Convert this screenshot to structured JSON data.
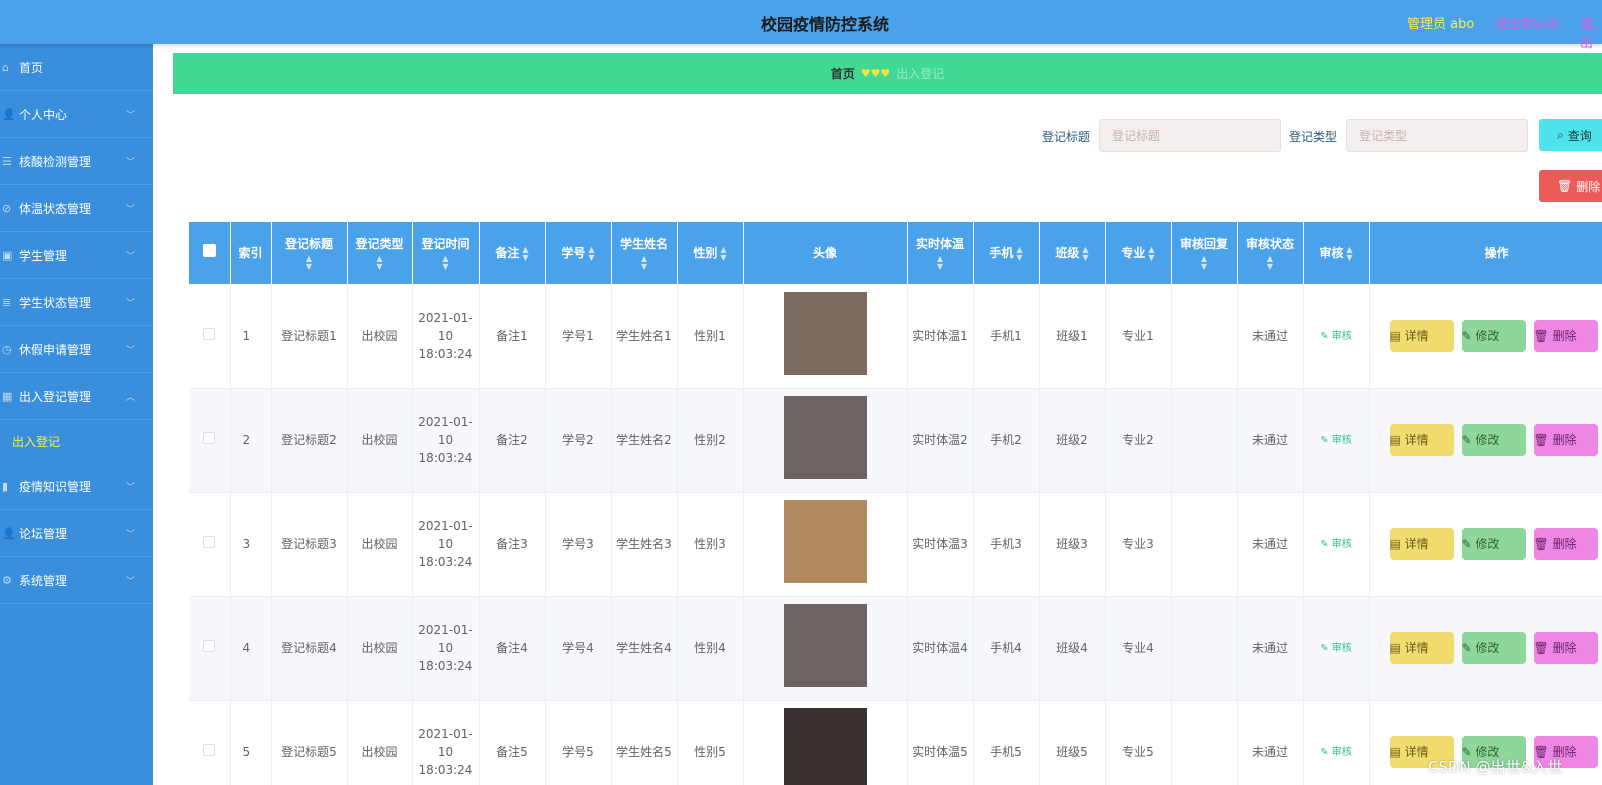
{
  "header": {
    "title": "校园疫情防控系统",
    "user": "管理员 abo",
    "back_label": "退出到前台",
    "logout_label": "退出"
  },
  "sidebar": {
    "items": [
      {
        "label": "首页",
        "icon": "home-icon",
        "chevron": ""
      },
      {
        "label": "个人中心",
        "icon": "user-icon",
        "chevron": "﹀"
      },
      {
        "label": "核酸检测管理",
        "icon": "sliders-icon",
        "chevron": "﹀"
      },
      {
        "label": "体温状态管理",
        "icon": "slash-icon",
        "chevron": "﹀"
      },
      {
        "label": "学生管理",
        "icon": "folder-icon",
        "chevron": "﹀"
      },
      {
        "label": "学生状态管理",
        "icon": "list-icon",
        "chevron": "﹀"
      },
      {
        "label": "休假申请管理",
        "icon": "clock-icon",
        "chevron": "﹀"
      },
      {
        "label": "出入登记管理",
        "icon": "grid-icon",
        "chevron": "︿"
      }
    ],
    "sub_item": "出入登记",
    "items_after": [
      {
        "label": "疫情知识管理",
        "icon": "chart-icon",
        "chevron": "﹀"
      },
      {
        "label": "论坛管理",
        "icon": "user-icon",
        "chevron": "﹀"
      },
      {
        "label": "系统管理",
        "icon": "settings-icon",
        "chevron": "﹀"
      }
    ]
  },
  "breadcrumb": {
    "home": "首页",
    "separator": "♥♥♥",
    "current": "出入登记"
  },
  "search": {
    "label1": "登记标题",
    "placeholder1": "登记标题",
    "label2": "登记类型",
    "placeholder2": "登记类型",
    "query_label": "查询",
    "delete_label": "删除"
  },
  "table": {
    "headers": [
      "索引",
      "登记标题",
      "登记类型",
      "登记时间",
      "备注",
      "学号",
      "学生姓名",
      "性别",
      "头像",
      "实时体温",
      "手机",
      "班级",
      "专业",
      "审核回复",
      "审核状态",
      "审核",
      "操作"
    ],
    "rows": [
      {
        "index": "1",
        "title": "登记标题1",
        "type": "出校园",
        "time": "2021-01-10 18:03:24",
        "note": "备注1",
        "sid": "学号1",
        "name": "学生姓名1",
        "gender": "性别1",
        "temp": "实时体温1",
        "phone": "手机1",
        "cls": "班级1",
        "major": "专业1",
        "reply": "",
        "status": "未通过",
        "audit": "审核",
        "avatar_color": "#7a6a60"
      },
      {
        "index": "2",
        "title": "登记标题2",
        "type": "出校园",
        "time": "2021-01-10 18:03:24",
        "note": "备注2",
        "sid": "学号2",
        "name": "学生姓名2",
        "gender": "性别2",
        "temp": "实时体温2",
        "phone": "手机2",
        "cls": "班级2",
        "major": "专业2",
        "reply": "",
        "status": "未通过",
        "audit": "审核",
        "avatar_color": "#6b6461"
      },
      {
        "index": "3",
        "title": "登记标题3",
        "type": "出校园",
        "time": "2021-01-10 18:03:24",
        "note": "备注3",
        "sid": "学号3",
        "name": "学生姓名3",
        "gender": "性别3",
        "temp": "实时体温3",
        "phone": "手机3",
        "cls": "班级3",
        "major": "专业3",
        "reply": "",
        "status": "未通过",
        "audit": "审核",
        "avatar_color": "#b08a5e"
      },
      {
        "index": "4",
        "title": "登记标题4",
        "type": "出校园",
        "time": "2021-01-10 18:03:24",
        "note": "备注4",
        "sid": "学号4",
        "name": "学生姓名4",
        "gender": "性别4",
        "temp": "实时体温4",
        "phone": "手机4",
        "cls": "班级4",
        "major": "专业4",
        "reply": "",
        "status": "未通过",
        "audit": "审核",
        "avatar_color": "#6b6461"
      },
      {
        "index": "5",
        "title": "登记标题5",
        "type": "出校园",
        "time": "2021-01-10 18:03:24",
        "note": "备注5",
        "sid": "学号5",
        "name": "学生姓名5",
        "gender": "性别5",
        "temp": "实时体温5",
        "phone": "手机5",
        "cls": "班级5",
        "major": "专业5",
        "reply": "",
        "status": "未通过",
        "audit": "审核",
        "avatar_color": "#3a3230"
      }
    ],
    "op_detail": "详情",
    "op_edit": "修改",
    "op_delete": "删除"
  },
  "watermark": "CSDN @出世&入世"
}
